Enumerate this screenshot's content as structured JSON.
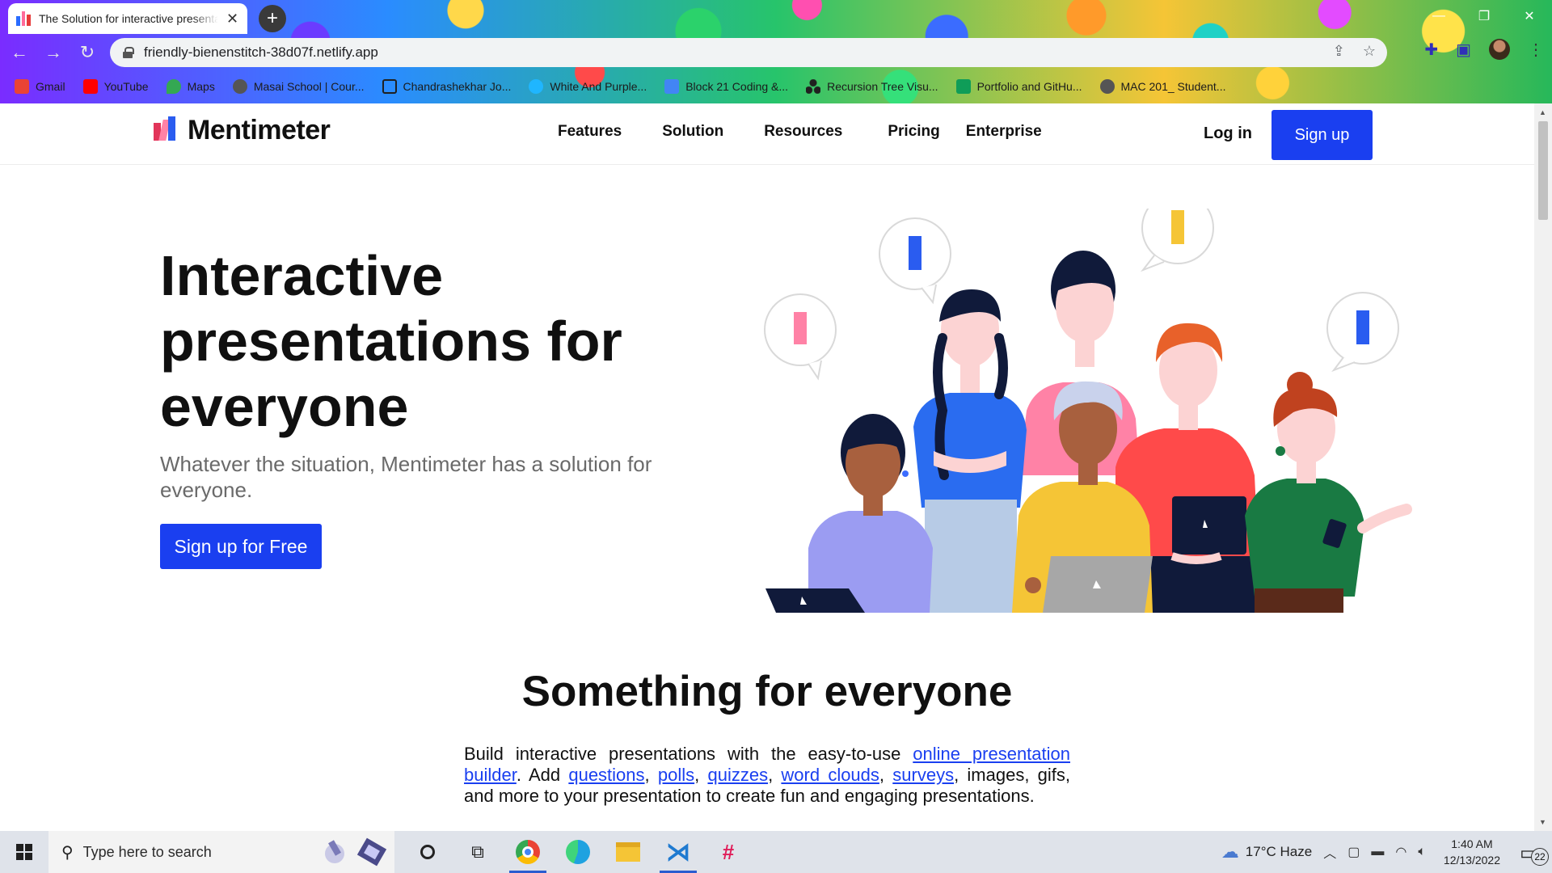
{
  "browser": {
    "tab_title": "The Solution for interactive presentations",
    "tab_close": "✕",
    "new_tab": "+",
    "url": "friendly-bienenstitch-38d07f.netlify.app",
    "bookmarks": [
      {
        "label": "Gmail",
        "icon": "gmail-icon",
        "color": "#ea4335"
      },
      {
        "label": "YouTube",
        "icon": "youtube-icon",
        "color": "#ff0000"
      },
      {
        "label": "Maps",
        "icon": "maps-icon",
        "color": "#34a853"
      },
      {
        "label": "Masai School | Cour...",
        "icon": "globe-icon",
        "color": "#555555"
      },
      {
        "label": "Chandrashekhar Jo...",
        "icon": "square-icon",
        "color": "#202020"
      },
      {
        "label": "White And Purple...",
        "icon": "canva-icon",
        "color": "#1fb6ff"
      },
      {
        "label": "Block 21 Coding &...",
        "icon": "docs-icon",
        "color": "#4285f4"
      },
      {
        "label": "Recursion Tree Visu...",
        "icon": "tree-icon",
        "color": "#202020"
      },
      {
        "label": "Portfolio and GitHu...",
        "icon": "sheets-icon",
        "color": "#0f9d58"
      },
      {
        "label": "MAC 201_ Student...",
        "icon": "globe-icon",
        "color": "#555555"
      }
    ]
  },
  "site": {
    "logo_text": "Mentimeter",
    "nav": [
      "Features",
      "Solution",
      "Resources",
      "Pricing",
      "Enterprise"
    ],
    "login_label": "Log in",
    "signup_label": "Sign up",
    "accent_color": "#1a3ff0"
  },
  "hero": {
    "title": "Interactive presentations for everyone",
    "subtitle": "Whatever the situation, Mentimeter has a solution for everyone.",
    "cta_label": "Sign up for Free"
  },
  "section": {
    "title": "Something for everyone",
    "body_parts": [
      {
        "text": "Build interactive presentations with the easy-to-use "
      },
      {
        "text": "online presentation builder",
        "link": true
      },
      {
        "text": ". Add "
      },
      {
        "text": "questions",
        "link": true
      },
      {
        "text": ", "
      },
      {
        "text": "polls",
        "link": true
      },
      {
        "text": ", "
      },
      {
        "text": "quizzes",
        "link": true
      },
      {
        "text": ", "
      },
      {
        "text": "word clouds",
        "link": true
      },
      {
        "text": ", "
      },
      {
        "text": "surveys",
        "link": true
      },
      {
        "text": ", images, gifs, and more to your presentation to create fun and engaging presentations."
      }
    ]
  },
  "taskbar": {
    "search_placeholder": "Type here to search",
    "weather": "17°C  Haze",
    "time": "1:40 AM",
    "date": "12/13/2022",
    "notification_count": "22"
  }
}
